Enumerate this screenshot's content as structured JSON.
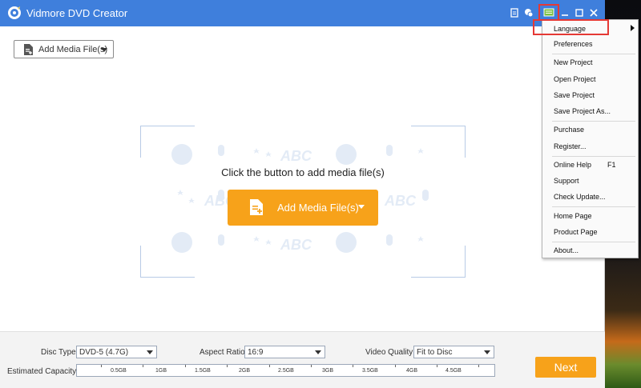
{
  "app": {
    "title": "Vidmore DVD Creator"
  },
  "toolbar": {
    "add_media_label": "Add Media File(s)"
  },
  "drop_area": {
    "hint": "Click the button to add media file(s)",
    "add_label": "Add Media File(s)",
    "pattern_text": "ABC"
  },
  "bottom": {
    "disc_type_label": "Disc Type",
    "disc_type_value": "DVD-5 (4.7G)",
    "aspect_ratio_label": "Aspect Ratio:",
    "aspect_ratio_value": "16:9",
    "video_quality_label": "Video Quality:",
    "video_quality_value": "Fit to Disc",
    "capacity_label": "Estimated Capacity:",
    "capacity_ticks": [
      "0.5GB",
      "1GB",
      "1.5GB",
      "2GB",
      "2.5GB",
      "3GB",
      "3.5GB",
      "4GB",
      "4.5GB"
    ],
    "next_label": "Next"
  },
  "menu": {
    "items": [
      {
        "label": "Language",
        "has_submenu": true
      },
      {
        "label": "Preferences"
      },
      {
        "label": "New Project"
      },
      {
        "label": "Open Project"
      },
      {
        "label": "Save Project"
      },
      {
        "label": "Save Project As..."
      },
      {
        "label": "Purchase"
      },
      {
        "label": "Register..."
      },
      {
        "label": "Online Help",
        "shortcut": "F1"
      },
      {
        "label": "Support"
      },
      {
        "label": "Check Update..."
      },
      {
        "label": "Home Page"
      },
      {
        "label": "Product Page"
      },
      {
        "label": "About..."
      }
    ]
  },
  "colors": {
    "titlebar": "#3f7fdc",
    "accent": "#f7a21a",
    "highlight": "#e53935"
  },
  "icons": [
    "app-logo-icon",
    "file-icon",
    "feedback-icon",
    "menu-icon",
    "minimize-icon",
    "maximize-icon",
    "close-icon",
    "add-file-icon",
    "chevron-down-icon",
    "submenu-arrow-icon"
  ]
}
